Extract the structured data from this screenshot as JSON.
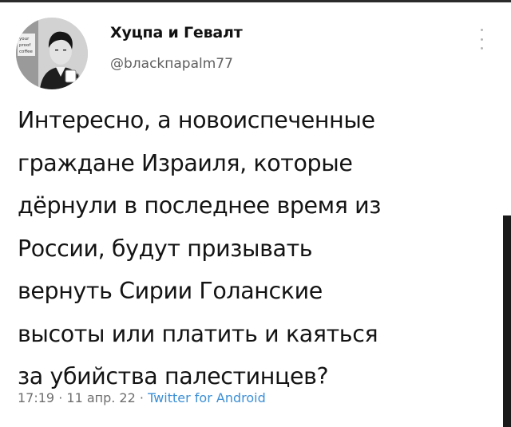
{
  "tweet": {
    "author": {
      "display_name": "Хуцпа и Гевалт",
      "handle": "@bлackпapalm77",
      "avatar_caption": [
        "your",
        "proof",
        "coffee"
      ]
    },
    "text_lines": [
      "Интересно, а новоиспеченные",
      "граждане Израиля, которые",
      "дёрнули в последнее время из",
      "России, будут призывать",
      "вернуть Сирии Голанские",
      "высоты или платить и каяться",
      "за убийства палестинцев?"
    ],
    "meta": {
      "time": "17:19",
      "separator": "·",
      "date": "11 апр. 22",
      "source": "Twitter for Android"
    }
  },
  "colors": {
    "text": "#141414",
    "secondary": "#6e6e6e",
    "link": "#3b8fd6",
    "menu_dots": "#b5b5b5",
    "scroll_thumb": "#1a1a1a"
  },
  "icons": {
    "more_menu": "vertical-ellipsis-icon"
  }
}
